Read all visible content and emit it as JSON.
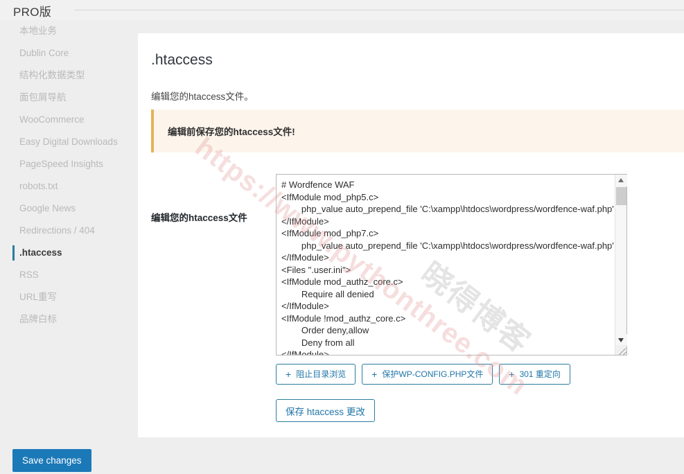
{
  "header": {
    "title": "PRO版"
  },
  "sidebar": {
    "items": [
      {
        "label": "本地业务",
        "active": false
      },
      {
        "label": "Dublin Core",
        "active": false
      },
      {
        "label": "结构化数据类型",
        "active": false
      },
      {
        "label": "面包屑导航",
        "active": false
      },
      {
        "label": "WooCommerce",
        "active": false
      },
      {
        "label": "Easy Digital Downloads",
        "active": false
      },
      {
        "label": "PageSpeed Insights",
        "active": false
      },
      {
        "label": "robots.txt",
        "active": false
      },
      {
        "label": "Google News",
        "active": false
      },
      {
        "label": "Redirections / 404",
        "active": false
      },
      {
        "label": ".htaccess",
        "active": true
      },
      {
        "label": "RSS",
        "active": false
      },
      {
        "label": "URL重写",
        "active": false
      },
      {
        "label": "品牌白标",
        "active": false
      }
    ]
  },
  "main": {
    "heading": ".htaccess",
    "description": "编辑您的htaccess文件。",
    "notice": {
      "text": "编辑前保存您的htaccess文件!",
      "accent_color": "#e3b457",
      "background_color": "#fdf5ec"
    },
    "field": {
      "label": "编辑您的htaccess文件",
      "value": "# Wordfence WAF\n<IfModule mod_php5.c>\n\tphp_value auto_prepend_file 'C:\\xampp\\htdocs\\wordpress/wordfence-waf.php'\n</IfModule>\n<IfModule mod_php7.c>\n\tphp_value auto_prepend_file 'C:\\xampp\\htdocs\\wordpress/wordfence-waf.php'\n</IfModule>\n<Files \".user.ini\">\n<IfModule mod_authz_core.c>\n\tRequire all denied\n</IfModule>\n<IfModule !mod_authz_core.c>\n\tOrder deny,allow\n\tDeny from all\n</IfModule>",
      "placeholder": ""
    },
    "action_buttons": [
      {
        "icon": "plus-icon",
        "plus": "+",
        "label": "阻止目录浏览"
      },
      {
        "icon": "plus-icon",
        "plus": "+",
        "label": "保护WP-CONFIG.PHP文件"
      },
      {
        "icon": "plus-icon",
        "plus": "+",
        "label": "301 重定向"
      }
    ],
    "save_htaccess_label": "保存 htaccess 更改"
  },
  "footer": {
    "save_changes_label": "Save changes",
    "save_changes_color": "#1c79b8"
  },
  "watermarks": {
    "url": "https://www.pythonthree.com",
    "site_name": "晓得博客"
  }
}
